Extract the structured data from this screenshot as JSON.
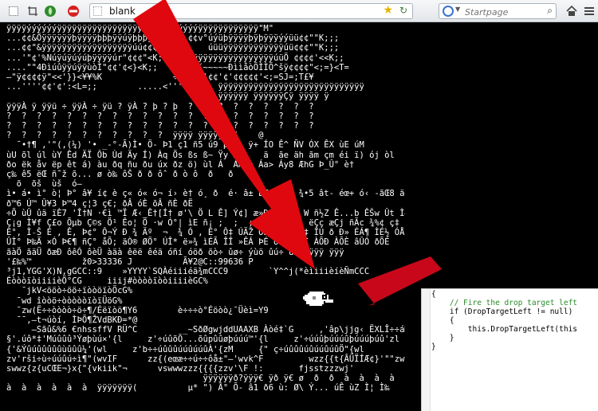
{
  "browser": {
    "url": "blank",
    "search_placeholder": "Startpage"
  },
  "garbled_lines": [
    "ÿÿÿÿýýýýýýÿÿÿÿÿÿÿÿÿÿÿÿÿÿÿÿÿÿÿÿÿýýýýýýýÿÿÿÿÿÿÿÿÿÿÿÿ\"M\"",
    "...¢¢&Öÿÿÿÿÿÿþÿÿÿÿþþþÿÿúÿþþþÿÿÿÿ ...¢¢v°úýüþÿÿÿÿþÿþÿÿÿýýüü¢¢\"\"K;;;",
    "...¢¢\"&ÿÿÿÿÿÿÿÿÿýÿÿÿÿÿÿÿÿúú¢¢¢\"\"K;;;    úüüÿÿÿÿÿÿÿÿÿÿÿÿúü¢¢¢\"\"K;;;",
    "...'\"¢'%Núÿúÿúýúþÿÿÿÿúr\"¢¢¢\"<K;;    ÿÿÿÿÿÿÿÿÿÿÿÿÿÿÿÿÿúüÖ ¢¢¢¢'<<K;;",
    "....\"\"4ÐìúûÿÿúÿÿùòÌ\"¢¢'¢<}<K;;    ÐìÌÌ´~~~~~ÐììåòÖÌÌÖ^šÿ¢¢¢¢\"<;=}<T=",
    "—\"ÿ¢¢¢¢ÿ\"<<'}}<¥¥%K              ÷   '¢'¢¢'¢'¢¢¢¢¢'<;=SJ=;T£¥",
    "...''''¢¢'¢':<L=;;        .....<''''\"     ÿÿÿÿÿÿÿÿÿÿÿÿÿÿÿÿÿÿÿÿÿÿÿÿÿÿÿÿÿ",
    "                                          ÿÿÿÿÿÿ ÿÿÿÿÿÿÇÿ ÿÿÿÿ ÿ",
    "ÿÿÿÀ ÿ ÿÿü ÷ ÿÿÀ ÷ ÿü ? ÿÀ ? þ ? þ  ?  ?  ?  ?  ?  ?  ?  ?  ?",
    "?  ?  ?  ?  ?  ?  ?  ?  ?  ?  ?  ?  ?  ?  ?  ?  ?  ?  ?  ?  ?",
    "?  ?  ?  ?  ?  ?  ?  ?  ?  ?  ?  ?  ?  ?  ?  ?  ?  ?  ?  ?  ?",
    "?  ?  ?  ?  ?  ?  ?  ?  ?  ?  ?  ÿÿÿÿ ÿÿÿÿÿ  (    @",
    "  ¯•†¶ ,'\"(,(¼) '• _-°-Ã)Ì• Ö- Þ1 ç1 ñ5 ú9 þ    ÿ+ ÍO Ê^ ÑV ÓX ÊX ùE úM",
    "ùU õl úl ùY Êd ÄÏ Ôb Ùd Äy Í) Àq Ös ßs ß~ Ÿy Á`    ä  ãe äh ãm çm éi ï) ój òl",
    "ðo ëk åv ëp êt á) àu ðq ñu ðu úx ðz ö) ùl Á  ÁÑ{% Áa> Áy8 ÆhG Þ_Û° è†",
    "ç‰ ê5 ëŒ ñ̃ ž õ... ø ò‰ ôŠ ð ð ôˆ ð ò ô  ð   ð",
    "  õ  õš  ùš  ó—",
    "ì• á• ì° ò¦ Þ° â¥ í¢ è ç« ó« ó¬ í› è† ó¸ ð  é· â± ÊÆ Þ‹   ¾•5 ât- éœ+ ó‹ -ãŒ8 ä<> ìŸ6",
    "ð™6 Ú™ Û¥3 Þ™4 ç¦3 ç€; ðÂ óÈ õÂ ñÈ ðË",
    "÷Õ ùÛ ûä ïÈ7 'Î†N ·€ì ™Ï Æ‹_Ê†[Í† ø'\\ Ö L Ê] Ý¢] æ»Ð    ½Ÿ W ñ½Z Ê...b ÊŠw Ût Ì—Ì",
    "Ç¡g Ì¥f Ç£o Õµb Ç©s Ö¹ Êo¦ Ö ·w Ó°| ìE ñ¡ ;  ;  ;    ; ; ;  ëÇç æÇj ñÃc ¾%¢ ç‡",
    "È°, Ì₋Š É , Ê, Þ¢° Ô¬Ý Ð ¾ Äº  ¬  ¾ Ó , Ê° Ô‡ ÚÄŽ ÕÉ   ¬ ÌÃ‡ ÎÚ ð Ð» ÉÁ¶ ÌÉ½ ÓÅµ",
    "ÛÌ° Þ‰Ä ×Ó Þ€¶ ñÇ° åÕ; äÒ® ØÖ° ÚÎ* ë»¾ ìÉÃ ÎÎ »ÊÁ ÞÉ ÛÓÀ ÓÖÌ ÀÕÐ ÀÕÈ âÛÓ ðÕÉ",
    "ãàÖ ãäÜ ðæÐ ôêÓ ôèÜ àäà êëë êéä óñí óöð õò÷ ûø÷ ýùö ûú÷ ùûþ ÿÿÿ ÿÿÿ",
    "'£‰%™          ž0>33336 J          Ã¥2@C::99636 P",
    "³j1,YGG'X)N,gGCC::9    »YYYY`SQÀéiiiéä¾mCCC9        `Y^^j(*èìiiièíèÑmCCC        ^iii-",
    "ÉòòòïòiiiièÖ°CG     iiij#òòòòïòòiiiièGC%",
    "   ¯jkV<ööò÷öö÷ïòòöïòÖcG%",
    "  ¯wd îòòö÷òòòòòïòïÜöG%",
    "  ¯zw(Ë÷÷òòòò÷ö÷¶/Éëïòö¶Y6        è÷÷÷ò°Éöòò¿¯Üèì=Y9",
    "  ¯¯,—t¬úòí, ÌÞÕ¶ŽVdBKÐ=*@",
    "     —Sãû&%6 €nhssffV RÜ^C         _~SðØgwjddUAAXB Àòé‡`G     ,'âp\\jjg‹ ËXLÎ÷÷áM",
    "§'.úô*‡'Múûûû³Ýøþùú×'{l     z'÷úûõÕ...õûpûûøþúúú™'{l     z'÷úúûþúúúûþúúúþúû'zl",
    "{'&Ýûúûûûûûùûûû¼'(wl     z'b÷÷úûûûúúûúúûÀ'{zM     {\" ç÷úûûûúûúúûúûÖ\"{wl",
    "zv'rši÷ù÷úúûú÷ì¶\"(wvIF      zz{(eœæ÷÷ú÷÷ôå±\"—'wvk^F         wzz{{t{ÂÜÏÍÆ¢}'\"\"zwi^^kF",
    "swwz{z{uCŒE¬}x{\"{vkiik\"¬      vswwwzzz{{{{zzv'\\F !:       fjsstzzzwj'",
    "                                       ÿÿÿÿÿÿð?ÿÿÿ€ ÿð ÿ€ ø  ð  ð  à  à  à  à  à  à  à  à",
    "à  à  à  à  à  à  ÿÿÿÿÿÿÿ(          µ* \") Â° Õ- â1 ð6 ù: Ø\\ Ý... úÊ ùZ Ì¦ Ì‰"
  ],
  "code_lines": [
    "{",
    "    // Fire the drop target left",
    "    if (DropTargetLeft != null)",
    "    {",
    "        this.DropTargetLeft(this",
    "    }",
    "}"
  ]
}
